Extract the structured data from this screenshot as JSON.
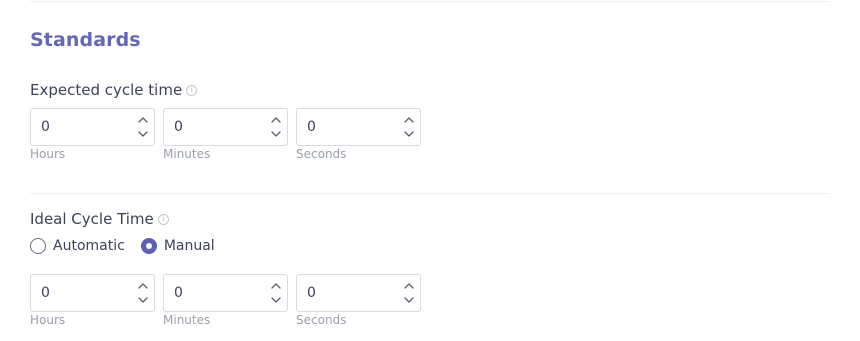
{
  "section": {
    "title": "Standards"
  },
  "expected_cycle_time": {
    "label": "Expected cycle time",
    "info_icon": "info-icon",
    "fields": [
      {
        "value": "0",
        "caption": "Hours"
      },
      {
        "value": "0",
        "caption": "Minutes"
      },
      {
        "value": "0",
        "caption": "Seconds"
      }
    ]
  },
  "ideal_cycle_time": {
    "label": "Ideal Cycle Time",
    "info_icon": "info-icon",
    "mode_options": [
      {
        "label": "Automatic",
        "selected": false
      },
      {
        "label": "Manual",
        "selected": true
      }
    ],
    "fields": [
      {
        "value": "0",
        "caption": "Hours"
      },
      {
        "value": "0",
        "caption": "Minutes"
      },
      {
        "value": "0",
        "caption": "Seconds"
      }
    ]
  },
  "colors": {
    "accent": "#5d61b0",
    "title": "#6468b2",
    "caption": "#9aa0ab",
    "border": "#d7dae0"
  }
}
